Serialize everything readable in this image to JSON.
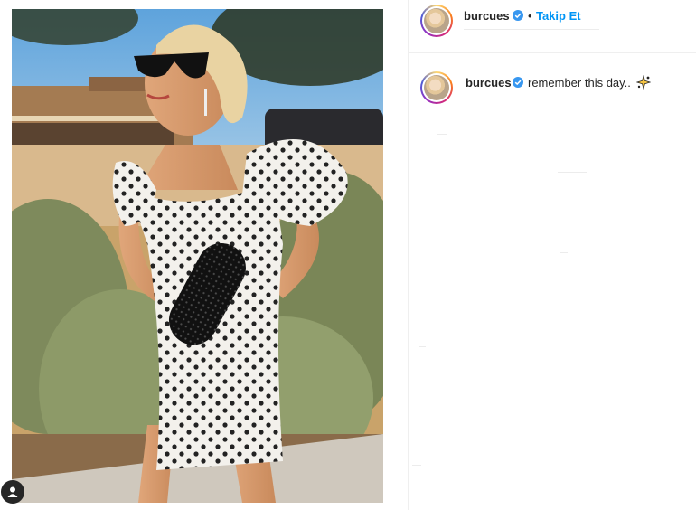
{
  "post": {
    "author": {
      "username": "burcues",
      "verified": true
    },
    "header": {
      "follow_separator": "•",
      "follow_label": "Takip Et"
    },
    "caption": {
      "username": "burcues",
      "text": "remember this day.."
    },
    "colors": {
      "link": "#0095f6",
      "verified": "#3897f0",
      "text": "#262626"
    },
    "icons": {
      "tag": "user-tag-icon",
      "verified": "verified-badge-icon",
      "caption_emoji": "sparkle-icon"
    }
  }
}
